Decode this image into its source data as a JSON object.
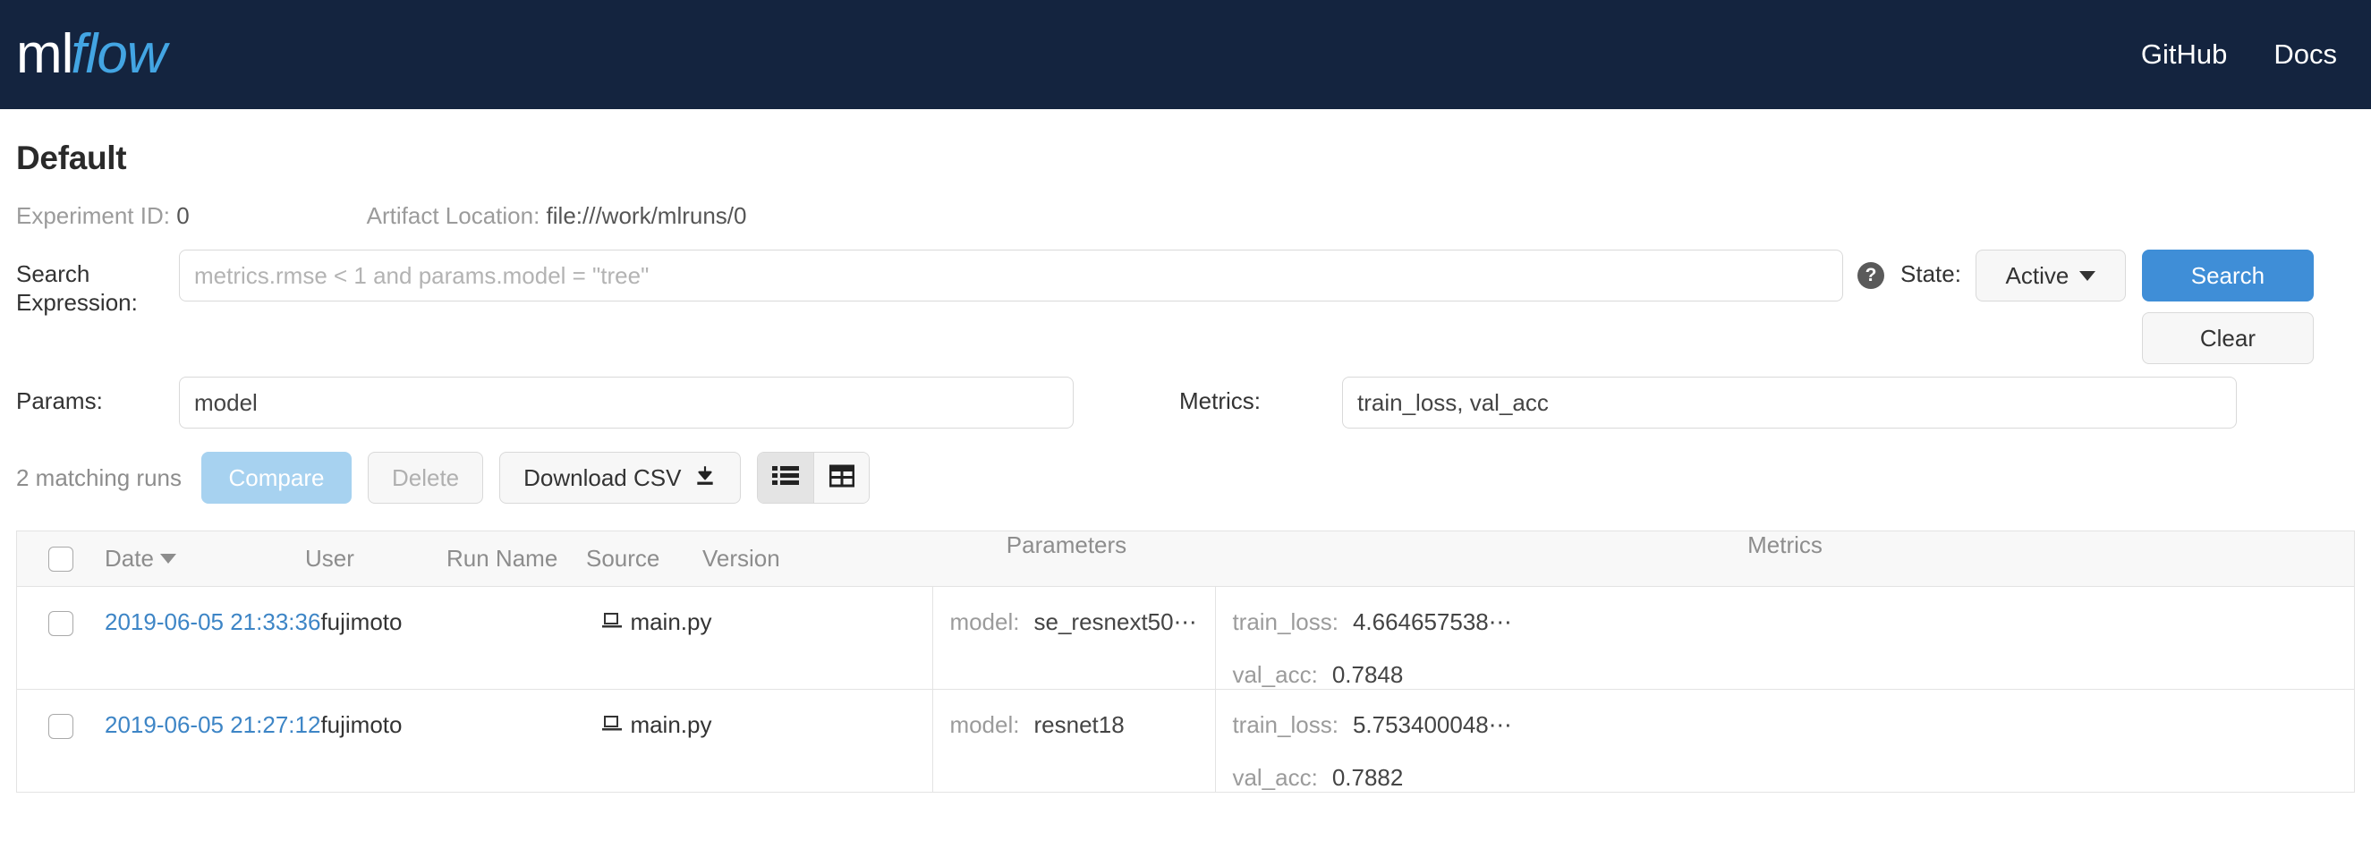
{
  "navbar": {
    "logo_ml": "ml",
    "logo_flow": "flow",
    "links": [
      {
        "label": "GitHub",
        "name": "nav-link-github"
      },
      {
        "label": "Docs",
        "name": "nav-link-docs"
      }
    ]
  },
  "experiment": {
    "title": "Default",
    "id_label": "Experiment ID:",
    "id_value": "0",
    "artifact_label": "Artifact Location:",
    "artifact_value": "file:///work/mlruns/0"
  },
  "search_form": {
    "search_expression_label": "Search Expression:",
    "search_expression_placeholder": "metrics.rmse < 1 and params.model = \"tree\"",
    "search_expression_value": "",
    "help_icon_label": "?",
    "state_label": "State:",
    "state_value": "Active",
    "search_button": "Search",
    "clear_button": "Clear",
    "params_label": "Params:",
    "params_value": "model",
    "metrics_label": "Metrics:",
    "metrics_value": "train_loss, val_acc"
  },
  "toolbar": {
    "matching_runs": "2 matching runs",
    "compare_button": "Compare",
    "delete_button": "Delete",
    "download_button": "Download CSV",
    "download_icon": "download-icon",
    "view_list_icon": "list-view-icon",
    "view_table_icon": "table-view-icon",
    "active_view": "list"
  },
  "runs_table": {
    "columns": [
      {
        "label": "Date",
        "sorted": true
      },
      {
        "label": "User"
      },
      {
        "label": "Run Name"
      },
      {
        "label": "Source"
      },
      {
        "label": "Version"
      },
      {
        "label": "Parameters"
      },
      {
        "label": "Metrics"
      }
    ],
    "rows": [
      {
        "date": "2019-06-05 21:33:36",
        "user": "fujimoto",
        "run_name": "",
        "source": "main.py",
        "source_icon": "laptop-icon",
        "version": "",
        "parameters": [
          {
            "key": "model:",
            "value": "se_resnext50⋯"
          }
        ],
        "metrics": [
          {
            "key": "train_loss:",
            "value": "4.664657538⋯"
          },
          {
            "key": "val_acc:",
            "value": "0.7848"
          }
        ]
      },
      {
        "date": "2019-06-05 21:27:12",
        "user": "fujimoto",
        "run_name": "",
        "source": "main.py",
        "source_icon": "laptop-icon",
        "version": "",
        "parameters": [
          {
            "key": "model:",
            "value": "resnet18"
          }
        ],
        "metrics": [
          {
            "key": "train_loss:",
            "value": "5.753400048⋯"
          },
          {
            "key": "val_acc:",
            "value": "0.7882"
          }
        ]
      }
    ]
  },
  "colors": {
    "navbar_bg": "#14243f",
    "logo_accent": "#43a5e3",
    "primary_button": "#3f8ed7",
    "compare_button": "#a7d2f0",
    "link": "#3d85c6"
  }
}
